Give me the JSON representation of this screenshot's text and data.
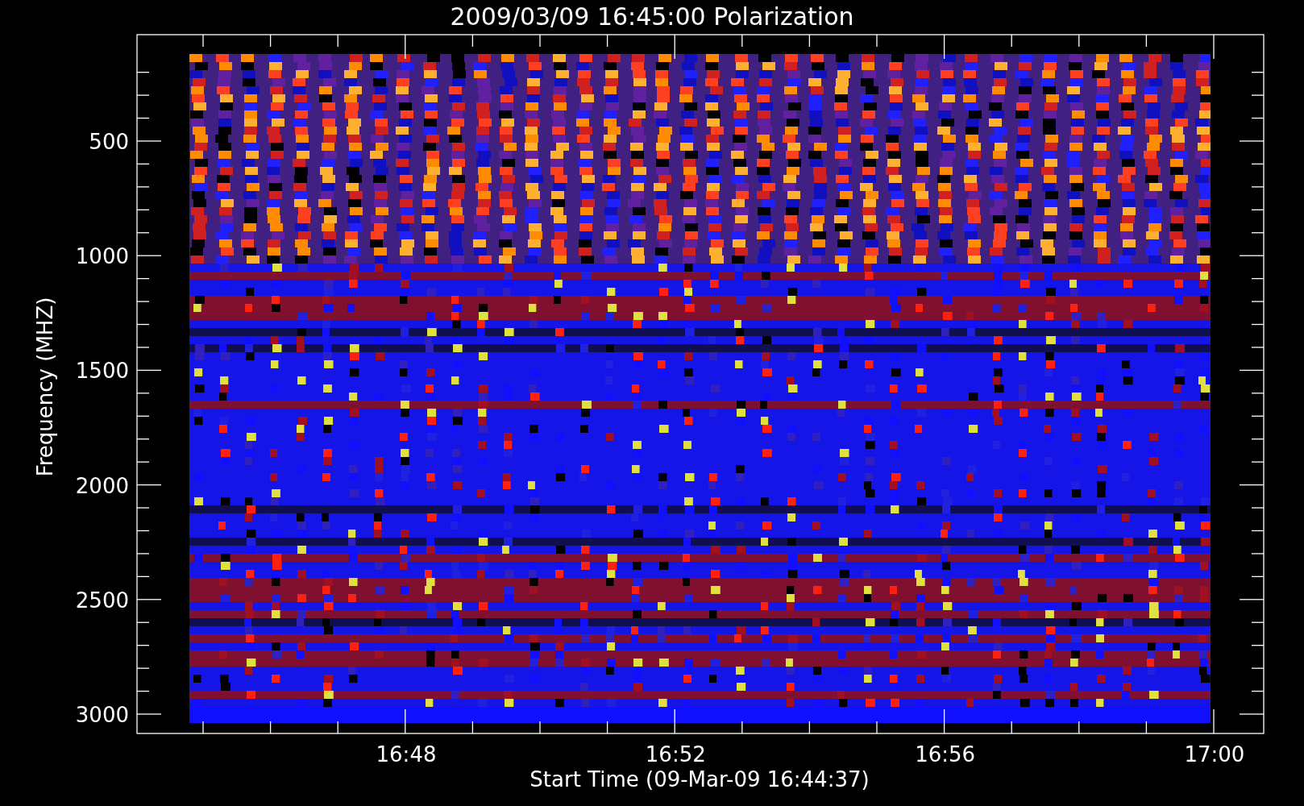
{
  "title": "2009/03/09 16:45:00 Polarization",
  "y_axis": {
    "label": "Frequency (MHZ)",
    "ticks": [
      "500",
      "1000",
      "1500",
      "2000",
      "2500",
      "3000"
    ]
  },
  "x_axis": {
    "label": "Start Time (09-Mar-09 16:44:37)",
    "ticks": [
      "16:48",
      "16:52",
      "16:56",
      "17:00"
    ]
  }
}
